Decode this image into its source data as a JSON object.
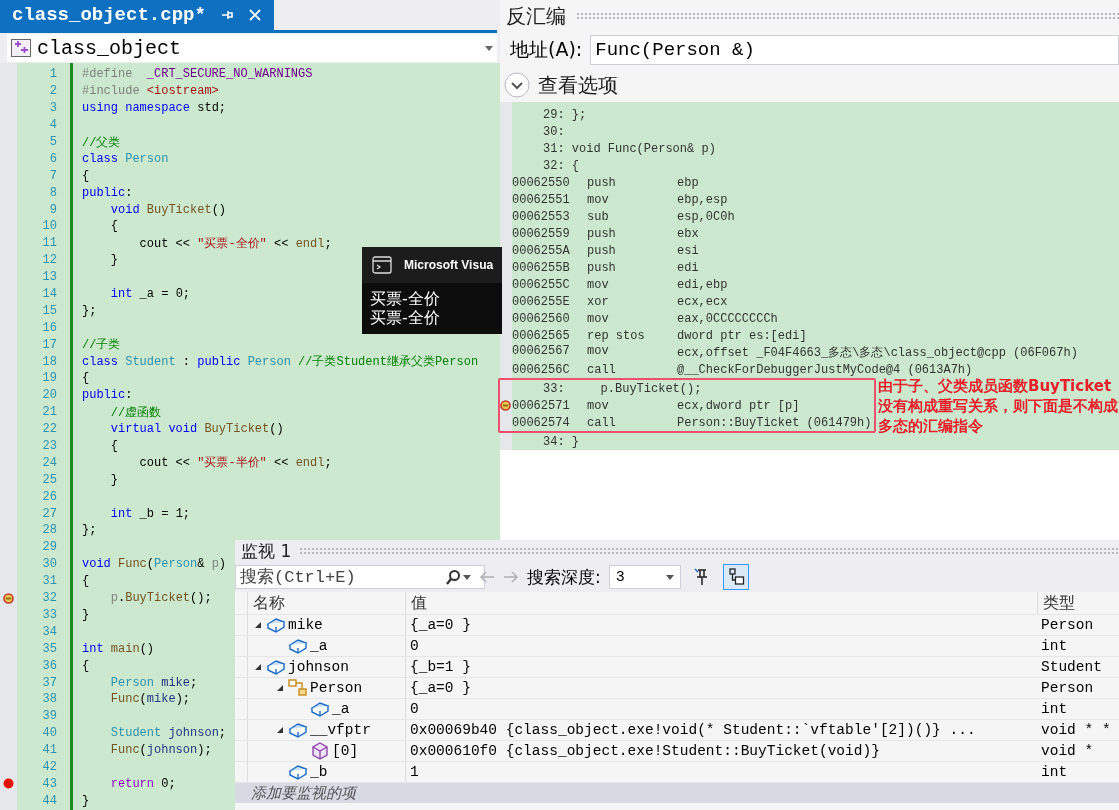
{
  "editor": {
    "tab": {
      "title": "class_object.cpp*",
      "selected": true
    },
    "scope": "class_object",
    "lines": [
      {
        "number": "1",
        "breakpoint": false,
        "tokens": [
          {
            "kind": "pp",
            "text": "#define  "
          },
          {
            "kind": "macro",
            "text": "_CRT_SECURE_NO_WARNINGS"
          }
        ]
      },
      {
        "number": "2",
        "breakpoint": false,
        "tokens": [
          {
            "kind": "pp",
            "text": "#include "
          },
          {
            "kind": "str",
            "text": "<iostream>"
          }
        ]
      },
      {
        "number": "3",
        "breakpoint": false,
        "tokens": [
          {
            "kind": "kw",
            "text": "using namespace"
          },
          {
            "kind": "plain",
            "text": " std;"
          }
        ]
      },
      {
        "number": "4",
        "breakpoint": false
      },
      {
        "number": "5",
        "breakpoint": false,
        "tokens": [
          {
            "kind": "cmt",
            "text": "//父类"
          }
        ]
      },
      {
        "number": "6",
        "breakpoint": false,
        "tokens": [
          {
            "kind": "kw",
            "text": "class "
          },
          {
            "kind": "type",
            "text": "Person"
          }
        ]
      },
      {
        "number": "7",
        "breakpoint": false,
        "tokens": [
          {
            "kind": "plain",
            "text": "{"
          }
        ]
      },
      {
        "number": "8",
        "breakpoint": false,
        "tokens": [
          {
            "kind": "kw",
            "text": "public"
          },
          {
            "kind": "plain",
            "text": ":"
          }
        ]
      },
      {
        "number": "9",
        "breakpoint": false,
        "tokens": [
          {
            "kind": "kw",
            "text": "    void "
          },
          {
            "kind": "fn",
            "text": "BuyTicket"
          },
          {
            "kind": "plain",
            "text": "()"
          }
        ]
      },
      {
        "number": "10",
        "breakpoint": false,
        "tokens": [
          {
            "kind": "plain",
            "text": "    {"
          }
        ]
      },
      {
        "number": "11",
        "breakpoint": false,
        "tokens": [
          {
            "kind": "plain",
            "text": "        cout << "
          },
          {
            "kind": "str",
            "text": "\"买票-全价\""
          },
          {
            "kind": "plain",
            "text": " << "
          },
          {
            "kind": "fn",
            "text": "endl"
          },
          {
            "kind": "plain",
            "text": ";"
          }
        ]
      },
      {
        "number": "12",
        "breakpoint": false,
        "tokens": [
          {
            "kind": "plain",
            "text": "    }"
          }
        ]
      },
      {
        "number": "13",
        "breakpoint": false
      },
      {
        "number": "14",
        "breakpoint": false,
        "tokens": [
          {
            "kind": "kw",
            "text": "    int"
          },
          {
            "kind": "plain",
            "text": " _a = 0;"
          }
        ]
      },
      {
        "number": "15",
        "breakpoint": false,
        "tokens": [
          {
            "kind": "plain",
            "text": "};"
          }
        ]
      },
      {
        "number": "16",
        "breakpoint": false
      },
      {
        "number": "17",
        "breakpoint": false,
        "tokens": [
          {
            "kind": "cmt",
            "text": "//子类"
          }
        ]
      },
      {
        "number": "18",
        "breakpoint": false,
        "tokens": [
          {
            "kind": "kw",
            "text": "class "
          },
          {
            "kind": "type",
            "text": "Student"
          },
          {
            "kind": "plain",
            "text": " : "
          },
          {
            "kind": "kw",
            "text": "public "
          },
          {
            "kind": "type",
            "text": "Person "
          },
          {
            "kind": "cmt",
            "text": "//子类Student继承父类Person"
          }
        ]
      },
      {
        "number": "19",
        "breakpoint": false,
        "tokens": [
          {
            "kind": "plain",
            "text": "{"
          }
        ]
      },
      {
        "number": "20",
        "breakpoint": false,
        "tokens": [
          {
            "kind": "kw",
            "text": "public"
          },
          {
            "kind": "plain",
            "text": ":"
          }
        ]
      },
      {
        "number": "21",
        "breakpoint": false,
        "tokens": [
          {
            "kind": "cmt",
            "text": "    //虚函数"
          }
        ]
      },
      {
        "number": "22",
        "breakpoint": false,
        "tokens": [
          {
            "kind": "kw",
            "text": "    virtual void "
          },
          {
            "kind": "fn",
            "text": "BuyTicket"
          },
          {
            "kind": "plain",
            "text": "()"
          }
        ]
      },
      {
        "number": "23",
        "breakpoint": false,
        "tokens": [
          {
            "kind": "plain",
            "text": "    {"
          }
        ]
      },
      {
        "number": "24",
        "breakpoint": false,
        "tokens": [
          {
            "kind": "plain",
            "text": "        cout << "
          },
          {
            "kind": "str",
            "text": "\"买票-半价\""
          },
          {
            "kind": "plain",
            "text": " << "
          },
          {
            "kind": "fn",
            "text": "endl"
          },
          {
            "kind": "plain",
            "text": ";"
          }
        ]
      },
      {
        "number": "25",
        "breakpoint": false,
        "tokens": [
          {
            "kind": "plain",
            "text": "    }"
          }
        ]
      },
      {
        "number": "26",
        "breakpoint": false
      },
      {
        "number": "27",
        "breakpoint": false,
        "tokens": [
          {
            "kind": "kw",
            "text": "    int"
          },
          {
            "kind": "plain",
            "text": " _b = 1;"
          }
        ]
      },
      {
        "number": "28",
        "breakpoint": false,
        "tokens": [
          {
            "kind": "plain",
            "text": "};"
          }
        ]
      },
      {
        "number": "29",
        "breakpoint": false
      },
      {
        "number": "30",
        "breakpoint": false,
        "tokens": [
          {
            "kind": "kw",
            "text": "void "
          },
          {
            "kind": "fn",
            "text": "Func"
          },
          {
            "kind": "plain",
            "text": "("
          },
          {
            "kind": "type",
            "text": "Person"
          },
          {
            "kind": "plain",
            "text": "& "
          },
          {
            "kind": "param",
            "text": "p"
          },
          {
            "kind": "plain",
            "text": ")"
          }
        ]
      },
      {
        "number": "31",
        "breakpoint": false,
        "tokens": [
          {
            "kind": "plain",
            "text": "{"
          }
        ]
      },
      {
        "number": "32",
        "breakpoint": true,
        "current": true,
        "tokens": [
          {
            "kind": "param",
            "text": "    p"
          },
          {
            "kind": "plain",
            "text": "."
          },
          {
            "kind": "fn",
            "text": "BuyTicket"
          },
          {
            "kind": "plain",
            "text": "();"
          }
        ]
      },
      {
        "number": "33",
        "breakpoint": false,
        "tokens": [
          {
            "kind": "plain",
            "text": "}"
          }
        ]
      },
      {
        "number": "34",
        "breakpoint": false
      },
      {
        "number": "35",
        "breakpoint": false,
        "tokens": [
          {
            "kind": "kw",
            "text": "int "
          },
          {
            "kind": "fn",
            "text": "main"
          },
          {
            "kind": "plain",
            "text": "()"
          }
        ]
      },
      {
        "number": "36",
        "breakpoint": false,
        "tokens": [
          {
            "kind": "plain",
            "text": "{"
          }
        ]
      },
      {
        "number": "37",
        "breakpoint": false,
        "tokens": [
          {
            "kind": "type",
            "text": "    Person "
          },
          {
            "kind": "var",
            "text": "mike"
          },
          {
            "kind": "plain",
            "text": ";"
          }
        ]
      },
      {
        "number": "38",
        "breakpoint": false,
        "tokens": [
          {
            "kind": "fn",
            "text": "    Func"
          },
          {
            "kind": "plain",
            "text": "("
          },
          {
            "kind": "var",
            "text": "mike"
          },
          {
            "kind": "plain",
            "text": ");"
          }
        ]
      },
      {
        "number": "39",
        "breakpoint": false
      },
      {
        "number": "40",
        "breakpoint": false,
        "tokens": [
          {
            "kind": "type",
            "text": "    Student "
          },
          {
            "kind": "var",
            "text": "johnson"
          },
          {
            "kind": "plain",
            "text": ";"
          }
        ]
      },
      {
        "number": "41",
        "breakpoint": false,
        "tokens": [
          {
            "kind": "fn",
            "text": "    Func"
          },
          {
            "kind": "plain",
            "text": "("
          },
          {
            "kind": "var",
            "text": "johnson"
          },
          {
            "kind": "plain",
            "text": ");"
          }
        ]
      },
      {
        "number": "42",
        "breakpoint": false
      },
      {
        "number": "43",
        "breakpoint": true,
        "current": false,
        "tokens": [
          {
            "kind": "ctl",
            "text": "    return"
          },
          {
            "kind": "plain",
            "text": " 0;"
          }
        ]
      },
      {
        "number": "44",
        "breakpoint": false,
        "tokens": [
          {
            "kind": "plain",
            "text": "}"
          }
        ]
      }
    ]
  },
  "console": {
    "title": "Microsoft Visua",
    "output": [
      "买票-全价",
      "买票-全价"
    ]
  },
  "disassembly": {
    "title": "反汇编",
    "address_label": "地址(A):",
    "address": "Func(Person &)",
    "options": {
      "label": "查看选项",
      "expanded": false
    },
    "lines": [
      {
        "kind": "source",
        "text": "29: };",
        "current": false
      },
      {
        "kind": "source",
        "text": "30:",
        "current": false
      },
      {
        "kind": "source",
        "text": "31: void Func(Person& p)",
        "current": false
      },
      {
        "kind": "source",
        "text": "32: {",
        "current": false
      },
      {
        "kind": "asm",
        "address": "00062550",
        "mnemonic": "push",
        "operands": "ebp",
        "current": false
      },
      {
        "kind": "asm",
        "address": "00062551",
        "mnemonic": "mov",
        "operands": "ebp,esp",
        "current": false
      },
      {
        "kind": "asm",
        "address": "00062553",
        "mnemonic": "sub",
        "operands": "esp,0C0h",
        "current": false
      },
      {
        "kind": "asm",
        "address": "00062559",
        "mnemonic": "push",
        "operands": "ebx",
        "current": false
      },
      {
        "kind": "asm",
        "address": "0006255A",
        "mnemonic": "push",
        "operands": "esi",
        "current": false
      },
      {
        "kind": "asm",
        "address": "0006255B",
        "mnemonic": "push",
        "operands": "edi",
        "current": false
      },
      {
        "kind": "asm",
        "address": "0006255C",
        "mnemonic": "mov",
        "operands": "edi,ebp",
        "current": false
      },
      {
        "kind": "asm",
        "address": "0006255E",
        "mnemonic": "xor",
        "operands": "ecx,ecx",
        "current": false
      },
      {
        "kind": "asm",
        "address": "00062560",
        "mnemonic": "mov",
        "operands": "eax,0CCCCCCCCh",
        "current": false
      },
      {
        "kind": "asm",
        "address": "00062565",
        "mnemonic": "rep stos",
        "operands": "dword ptr es:[edi]",
        "current": false
      },
      {
        "kind": "asm",
        "address": "00062567",
        "mnemonic": "mov",
        "operands": "ecx,offset _F04F4663_多态\\多态\\class_object@cpp (06F067h)",
        "current": false
      },
      {
        "kind": "asm",
        "address": "0006256C",
        "mnemonic": "call",
        "operands": "@__CheckForDebuggerJustMyCode@4 (0613A7h)",
        "current": false
      }
    ],
    "callout": {
      "lines": [
        {
          "kind": "source",
          "text": "33:     p.BuyTicket();",
          "current": false
        },
        {
          "kind": "asm",
          "address": "00062571",
          "mnemonic": "mov",
          "operands": "ecx,dword ptr [p]",
          "current": true
        },
        {
          "kind": "asm",
          "address": "00062574",
          "mnemonic": "call",
          "operands": "Person::BuyTicket (061479h)",
          "current": false
        }
      ],
      "note": "由于子、父类成员函数BuyTicket没有构成重写关系，则下面是不构成多态的汇编指令"
    },
    "lines_after": [
      {
        "kind": "source",
        "text": "34: }",
        "current": false
      }
    ]
  },
  "watch": {
    "title": "监视 1",
    "search": {
      "placeholder": "搜索(Ctrl+E)"
    },
    "depth_label": "搜索深度:",
    "depth": "3",
    "tools": [
      {
        "kind": "pin",
        "selected": false
      },
      {
        "kind": "hex",
        "selected": true
      }
    ],
    "columns": [
      "名称",
      "值",
      "类型"
    ],
    "rows": [
      {
        "name": "mike",
        "value": "{_a=0 }",
        "type": "Person",
        "kind": "object",
        "expanded": true,
        "children": [
          {
            "name": "_a",
            "value": "0",
            "type": "int",
            "kind": "object"
          }
        ]
      },
      {
        "name": "johnson",
        "value": "{_b=1 }",
        "type": "Student",
        "kind": "object",
        "expanded": true,
        "children": [
          {
            "name": "Person",
            "value": "{_a=0 }",
            "type": "Person",
            "kind": "base",
            "expanded": true,
            "children": [
              {
                "name": "_a",
                "value": "0",
                "type": "int",
                "kind": "object"
              }
            ]
          },
          {
            "name": "__vfptr",
            "value": "0x00069b40 {class_object.exe!void(* Student::`vftable'[2])()} ...",
            "type": "void * *",
            "kind": "object",
            "expanded": true,
            "children": [
              {
                "name": "[0]",
                "value": "0x000610f0 {class_object.exe!Student::BuyTicket(void)}",
                "type": "void *",
                "kind": "element"
              }
            ]
          },
          {
            "name": "_b",
            "value": "1",
            "type": "int",
            "kind": "object"
          }
        ]
      }
    ],
    "add_hint": "添加要监视的项"
  }
}
